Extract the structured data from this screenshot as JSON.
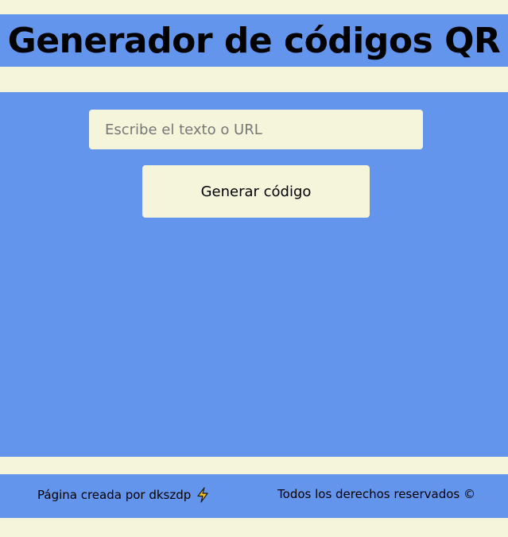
{
  "header": {
    "title": "Generador de códigos QR"
  },
  "form": {
    "input_placeholder": "Escribe el texto o URL",
    "input_value": "",
    "button_label": "Generar código"
  },
  "footer": {
    "credit_text": "Página creada por dkszdp",
    "credit_icon": "lightning-bolt-icon",
    "rights_text": "Todos los derechos reservados ©"
  },
  "colors": {
    "page_background": "#f5f5dc",
    "panel_background": "#6495ed",
    "bolt_fill": "#f5c518"
  }
}
